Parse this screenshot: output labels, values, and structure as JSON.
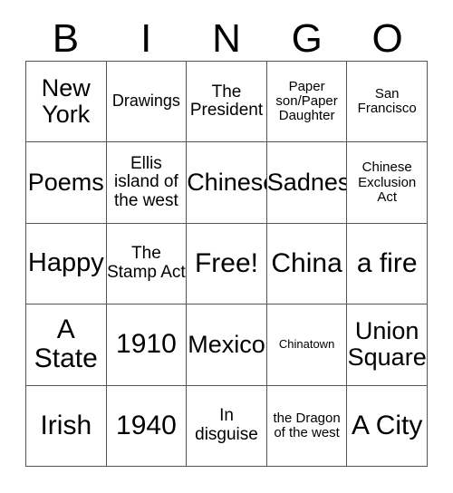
{
  "card": {
    "title": "BINGO card",
    "background_color": "#ffffff",
    "border_color": "#555555",
    "text_color": "#000000"
  },
  "header": {
    "letters": [
      "B",
      "I",
      "N",
      "G",
      "O"
    ]
  },
  "grid": {
    "columns": 5,
    "rows": 5,
    "free_space": "Free!",
    "cells": [
      [
        {
          "text": "New York",
          "size": "s-lg"
        },
        {
          "text": "Drawings",
          "size": "s-sm"
        },
        {
          "text": "The President",
          "size": "s-md"
        },
        {
          "text": "Paper son/Paper Daughter",
          "size": "s-xs"
        },
        {
          "text": "San Francisco",
          "size": "s-xs"
        }
      ],
      [
        {
          "text": "Poems",
          "size": "s-lg"
        },
        {
          "text": "Ellis island of the west",
          "size": "s-md"
        },
        {
          "text": "Chinese",
          "size": "s-lg"
        },
        {
          "text": "Sadness",
          "size": "s-lg"
        },
        {
          "text": "Chinese Exclusion Act",
          "size": "s-xs"
        }
      ],
      [
        {
          "text": "Happy",
          "size": "s-xl"
        },
        {
          "text": "The Stamp Act",
          "size": "s-md"
        },
        {
          "text": "Free!",
          "size": "s-xxl"
        },
        {
          "text": "China",
          "size": "s-xxl"
        },
        {
          "text": "a fire",
          "size": "s-xxl"
        }
      ],
      [
        {
          "text": "A State",
          "size": "s-xxl"
        },
        {
          "text": "1910",
          "size": "s-xxl"
        },
        {
          "text": "Mexico",
          "size": "s-lg"
        },
        {
          "text": "Chinatown",
          "size": "s-xxs"
        },
        {
          "text": "Union Square",
          "size": "s-lg"
        }
      ],
      [
        {
          "text": "Irish",
          "size": "s-xxl"
        },
        {
          "text": "1940",
          "size": "s-xxl"
        },
        {
          "text": "In disguise",
          "size": "s-md"
        },
        {
          "text": "the Dragon of the west",
          "size": "s-xs"
        },
        {
          "text": "A City",
          "size": "s-xxl"
        }
      ]
    ]
  }
}
